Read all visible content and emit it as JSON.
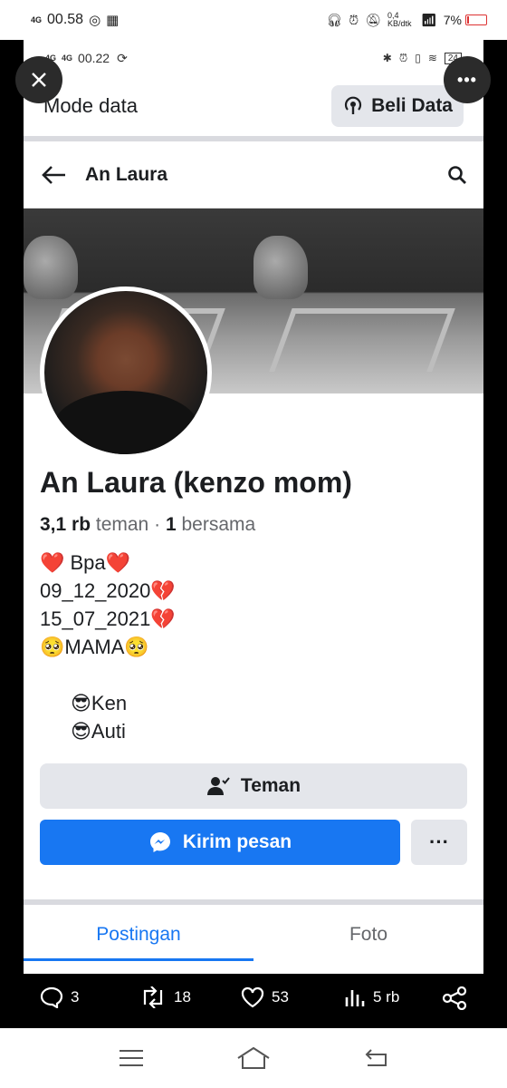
{
  "outer_status": {
    "network": "4G",
    "time": "00.58",
    "speed": "0,4 KB/dtk",
    "battery": "7%",
    "battery_level": 0.07
  },
  "inner_status": {
    "network_a": "4G",
    "network_b": "4G",
    "time": "00.22",
    "battery": "24"
  },
  "header": {
    "mode_label": "Mode data",
    "beli_label": "Beli Data",
    "title": "An Laura"
  },
  "profile": {
    "name": "An Laura (kenzo mom)",
    "friends_count": "3,1 rb",
    "friends_label": "teman",
    "mutual_count": "1",
    "mutual_label": "bersama",
    "bio": [
      "❤️ Bpa❤️",
      "09_12_2020💔",
      "15_07_2021💔",
      "🥺MAMA🥺",
      "😎Ken",
      "😎Auti"
    ]
  },
  "buttons": {
    "teman": "Teman",
    "kirim": "Kirim pesan",
    "more": "···"
  },
  "tabs": [
    "Postingan",
    "Foto"
  ],
  "actions": {
    "replies": "3",
    "retweets": "18",
    "likes": "53",
    "views": "5 rb"
  },
  "colors": {
    "accent": "#1877f2",
    "button_gray": "#e4e6eb"
  }
}
